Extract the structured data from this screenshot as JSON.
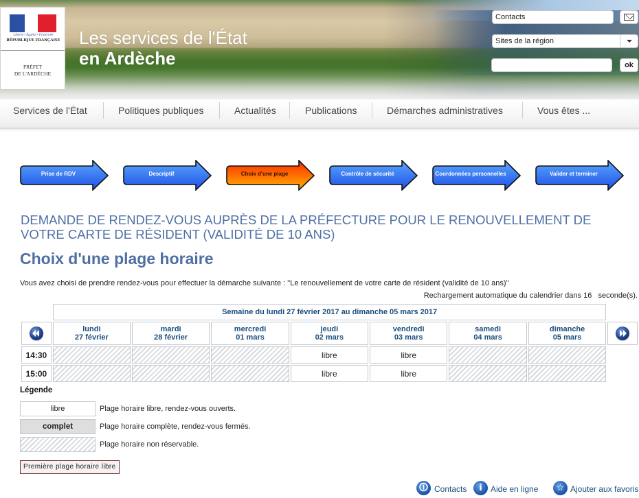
{
  "header": {
    "logo": {
      "devise": "Liberté • Égalité • Fraternité",
      "republique": "RÉPUBLIQUE FRANÇAISE",
      "prefet_line1": "PRÉFET",
      "prefet_line2": "DE L'ARDÈCHE"
    },
    "title_line1": "Les services de l'État",
    "title_line2": "en Ardèche",
    "contacts_field": "Contacts",
    "contacts_icon": "mail-icon",
    "region_select": "Sites de la région",
    "search_value": "",
    "ok_label": "ok"
  },
  "nav": {
    "items": [
      {
        "label": "Services de l'État"
      },
      {
        "label": "Politiques publiques"
      },
      {
        "label": "Actualités"
      },
      {
        "label": "Publications"
      },
      {
        "label": "Démarches administratives"
      },
      {
        "label": "Vous êtes ..."
      }
    ]
  },
  "steps": [
    {
      "label": "Prise de RDV",
      "active": false
    },
    {
      "label": "Descriptif",
      "active": false
    },
    {
      "label": "Choix d'une plage",
      "active": true
    },
    {
      "label": "Contrôle de sécurité",
      "active": false
    },
    {
      "label": "Coordonnées personnelles",
      "active": false
    },
    {
      "label": "Valider et terminer",
      "active": false
    }
  ],
  "colors": {
    "step_blue_top": "#5aa8ff",
    "step_blue_bottom": "#1f4fe6",
    "step_active_top": "#ff2a00",
    "step_active_bottom": "#ffb300",
    "heading": "#4f6fa4",
    "calendar_text": "#1a4e7d"
  },
  "main": {
    "page_heading": "DEMANDE DE RENDEZ-VOUS AUPRÈS DE LA PRÉFECTURE POUR LE RENOUVELLEMENT DE VOTRE CARTE DE RÉSIDENT (VALIDITÉ DE 10 ANS)",
    "section_title": "Choix d'une plage horaire",
    "intro": "Vous avez choisi de prendre rendez-vous pour effectuer la démarche suivante : \"Le renouvellement de votre carte de résident (validité de 10 ans)\"",
    "reload_prefix": "Rechargement automatique du calendrier dans",
    "reload_seconds": "16",
    "reload_suffix": "seconde(s)."
  },
  "calendar": {
    "week_title": "Semaine du lundi 27 février 2017 au dimanche 05 mars 2017",
    "prev_icon": "rewind-icon",
    "next_icon": "fast-forward-icon",
    "days": [
      {
        "name": "lundi",
        "date": "27 février"
      },
      {
        "name": "mardi",
        "date": "28 février"
      },
      {
        "name": "mercredi",
        "date": "01 mars"
      },
      {
        "name": "jeudi",
        "date": "02 mars"
      },
      {
        "name": "vendredi",
        "date": "03 mars"
      },
      {
        "name": "samedi",
        "date": "04 mars"
      },
      {
        "name": "dimanche",
        "date": "05 mars"
      }
    ],
    "rows": [
      {
        "time": "14:30",
        "slots": [
          {
            "status": "non-reservable",
            "label": ""
          },
          {
            "status": "non-reservable",
            "label": ""
          },
          {
            "status": "non-reservable",
            "label": ""
          },
          {
            "status": "libre",
            "label": "libre"
          },
          {
            "status": "libre",
            "label": "libre"
          },
          {
            "status": "non-reservable",
            "label": ""
          },
          {
            "status": "non-reservable",
            "label": ""
          }
        ]
      },
      {
        "time": "15:00",
        "slots": [
          {
            "status": "non-reservable",
            "label": ""
          },
          {
            "status": "non-reservable",
            "label": ""
          },
          {
            "status": "non-reservable",
            "label": ""
          },
          {
            "status": "libre",
            "label": "libre"
          },
          {
            "status": "libre",
            "label": "libre"
          },
          {
            "status": "non-reservable",
            "label": ""
          },
          {
            "status": "non-reservable",
            "label": ""
          }
        ]
      }
    ]
  },
  "legend": {
    "title": "Légende",
    "items": [
      {
        "box": "libre",
        "text": "Plage horaire libre, rendez-vous ouverts."
      },
      {
        "box": "complet",
        "text": "Plage horaire complète, rendez-vous fermés."
      },
      {
        "box": "",
        "text": "Plage horaire non réservable."
      }
    ],
    "first_slot_button": "Première plage horaire libre"
  },
  "footer": {
    "links": [
      {
        "label": "Contacts",
        "icon": "person-icon"
      },
      {
        "label": "Aide en ligne",
        "icon": "info-icon"
      },
      {
        "label": "Ajouter aux favoris",
        "icon": "star-icon"
      }
    ]
  }
}
